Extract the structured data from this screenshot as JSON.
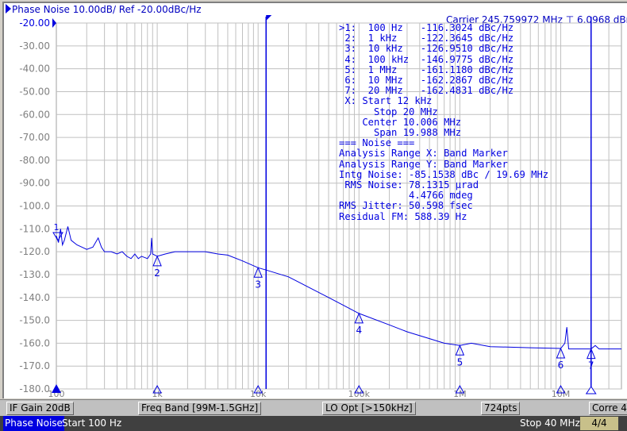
{
  "header": {
    "title": "Phase Noise 10.00dB/ Ref -20.00dBc/Hz",
    "carrier": "Carrier 245.759972 MHz",
    "carrier_power": "6.0968 dBm"
  },
  "marker_table": [
    ">1:  100 Hz   -116.3024 dBc/Hz",
    " 2:  1 kHz    -122.3645 dBc/Hz",
    " 3:  10 kHz   -126.9510 dBc/Hz",
    " 4:  100 kHz  -146.9775 dBc/Hz",
    " 5:  1 MHz    -161.1180 dBc/Hz",
    " 6:  10 MHz   -162.2867 dBc/Hz",
    " 7:  20 MHz   -162.4831 dBc/Hz",
    " X: Start 12 kHz",
    "      Stop 20 MHz",
    "    Center 10.006 MHz",
    "      Span 19.988 MHz",
    "=== Noise ===",
    "Analysis Range X: Band Marker",
    "Analysis Range Y: Band Marker",
    "Intg Noise: -85.1538 dBc / 19.69 MHz",
    " RMS Noise: 78.1315 µrad",
    "            4.4766 mdeg",
    "RMS Jitter: 50.598 fsec",
    "Residual FM: 588.39 Hz"
  ],
  "chart_data": {
    "type": "line",
    "x_scale": "log",
    "xlim": [
      100,
      40000000
    ],
    "ylim": [
      -180,
      -20
    ],
    "grid": true,
    "y_ticks": [
      "-20.00",
      "-30.00",
      "-40.00",
      "-50.00",
      "-60.00",
      "-70.00",
      "-80.00",
      "-90.00",
      "-100.0",
      "-110.0",
      "-120.0",
      "-130.0",
      "-140.0",
      "-150.0",
      "-160.0",
      "-170.0",
      "-180.0"
    ],
    "x_ticks": [
      {
        "v": 100,
        "label": "100"
      },
      {
        "v": 1000,
        "label": "1k"
      },
      {
        "v": 10000,
        "label": "10k"
      },
      {
        "v": 100000,
        "label": "100k"
      },
      {
        "v": 1000000,
        "label": "1M"
      },
      {
        "v": 10000000,
        "label": "10M"
      }
    ],
    "band_markers": [
      12000,
      20000000
    ],
    "trace": [
      [
        100,
        -113
      ],
      [
        105,
        -116
      ],
      [
        110,
        -110
      ],
      [
        115,
        -117
      ],
      [
        120,
        -115
      ],
      [
        130,
        -109
      ],
      [
        140,
        -115
      ],
      [
        160,
        -117
      ],
      [
        180,
        -118
      ],
      [
        200,
        -119
      ],
      [
        230,
        -118
      ],
      [
        260,
        -114
      ],
      [
        280,
        -118
      ],
      [
        300,
        -120
      ],
      [
        350,
        -120
      ],
      [
        400,
        -121
      ],
      [
        450,
        -120
      ],
      [
        500,
        -122
      ],
      [
        550,
        -123
      ],
      [
        600,
        -121
      ],
      [
        650,
        -123
      ],
      [
        700,
        -122
      ],
      [
        800,
        -123
      ],
      [
        860,
        -121
      ],
      [
        880,
        -114
      ],
      [
        900,
        -121
      ],
      [
        1000,
        -122
      ],
      [
        1200,
        -121
      ],
      [
        1500,
        -120
      ],
      [
        2000,
        -120
      ],
      [
        3000,
        -120
      ],
      [
        4000,
        -121
      ],
      [
        5000,
        -121.5
      ],
      [
        7000,
        -124
      ],
      [
        10000,
        -127
      ],
      [
        12000,
        -128
      ],
      [
        20000,
        -131
      ],
      [
        30000,
        -135
      ],
      [
        50000,
        -140
      ],
      [
        100000,
        -147
      ],
      [
        200000,
        -152
      ],
      [
        300000,
        -155
      ],
      [
        500000,
        -158
      ],
      [
        700000,
        -160
      ],
      [
        1000000,
        -161
      ],
      [
        1300000,
        -160
      ],
      [
        2000000,
        -161.5
      ],
      [
        5000000,
        -162
      ],
      [
        10000000,
        -162.3
      ],
      [
        11000000,
        -160
      ],
      [
        11500000,
        -153
      ],
      [
        12000000,
        -162.5
      ],
      [
        20000000,
        -162.5
      ],
      [
        22000000,
        -161
      ],
      [
        24000000,
        -162.5
      ],
      [
        40000000,
        -162.5
      ]
    ],
    "markers": [
      {
        "n": "1",
        "f": 100,
        "v": -116.3024
      },
      {
        "n": "2",
        "f": 1000,
        "v": -122.3645
      },
      {
        "n": "3",
        "f": 10000,
        "v": -126.951
      },
      {
        "n": "4",
        "f": 100000,
        "v": -146.9775
      },
      {
        "n": "5",
        "f": 1000000,
        "v": -161.118
      },
      {
        "n": "6",
        "f": 10000000,
        "v": -162.2867
      },
      {
        "n": "7",
        "f": 20000000,
        "v": -162.4831
      }
    ],
    "trace_color": "#0000e0",
    "grid_color": "#c0c0c0"
  },
  "status": {
    "if_gain": "IF Gain 20dB",
    "freq_band": "Freq Band [99M-1.5GHz]",
    "lo_opt": "LO Opt [>150kHz]",
    "points": "724pts",
    "corr": "Corre 4"
  },
  "bottom": {
    "mode": "Phase Noise",
    "start": "Start 100 Hz",
    "stop": "Stop 40 MHz",
    "page": "4/4"
  }
}
